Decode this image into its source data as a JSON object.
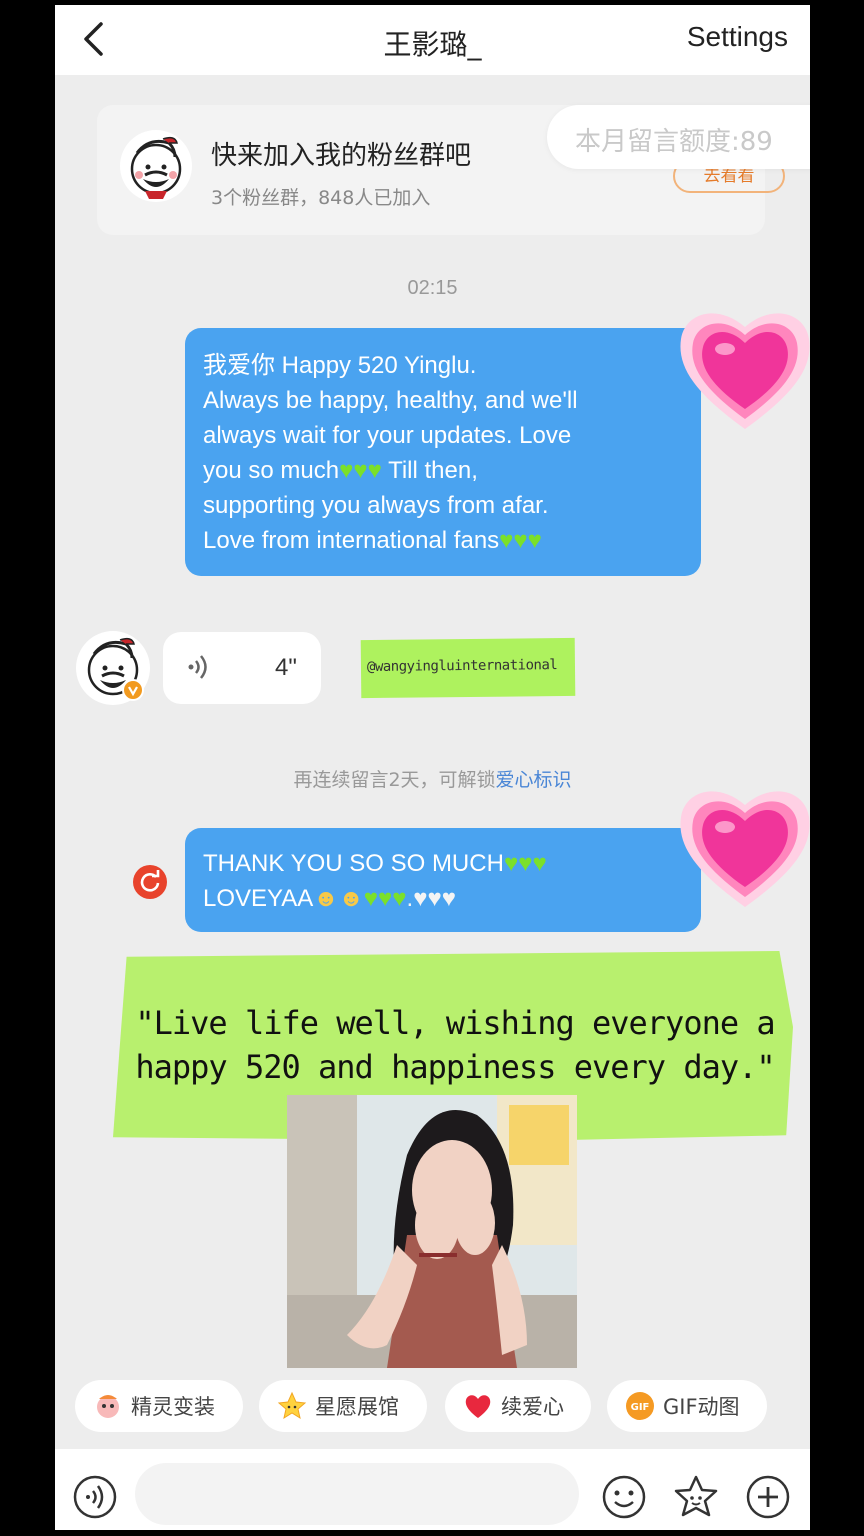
{
  "header": {
    "title": "王影璐_",
    "settings_label": "Settings"
  },
  "fan_group": {
    "title": "快来加入我的粉丝群吧",
    "subtitle": "3个粉丝群，848人已加入",
    "view_button": "去看看",
    "quota": "本月留言额度:89"
  },
  "chat": {
    "timestamp": "02:15",
    "message1": {
      "line1": "我爱你 Happy 520 Yinglu.",
      "line2": "Always be happy, healthy, and we'll",
      "line3": "always wait for your updates. Love",
      "line4a": "you so much",
      "line4b": " Till then,",
      "line5": "supporting you always from afar.",
      "line6": "Love from international fans"
    },
    "voice": {
      "duration": "4\""
    },
    "watermark": "@wangyingluinternational",
    "unlock_hint": "再连续留言2天，可解锁",
    "unlock_link": "爱心标识",
    "message2": {
      "line1": "THANK YOU SO SO MUCH",
      "line2": "LOVEYAA"
    },
    "quote": "\"Live life well, wishing everyone a happy 520 and happiness every day.\""
  },
  "quick_actions": [
    {
      "label": "精灵变装",
      "icon": "fairy-icon"
    },
    {
      "label": "星愿展馆",
      "icon": "star-icon"
    },
    {
      "label": "续爱心",
      "icon": "heart-icon"
    },
    {
      "label": "GIF动图",
      "icon": "gif-icon"
    }
  ],
  "input": {
    "placeholder": ""
  },
  "colors": {
    "bubble_blue": "#4aa3f0",
    "tape_green": "#b8f06e",
    "heart_pink": "#f0359a",
    "link_blue": "#4a86d6"
  }
}
